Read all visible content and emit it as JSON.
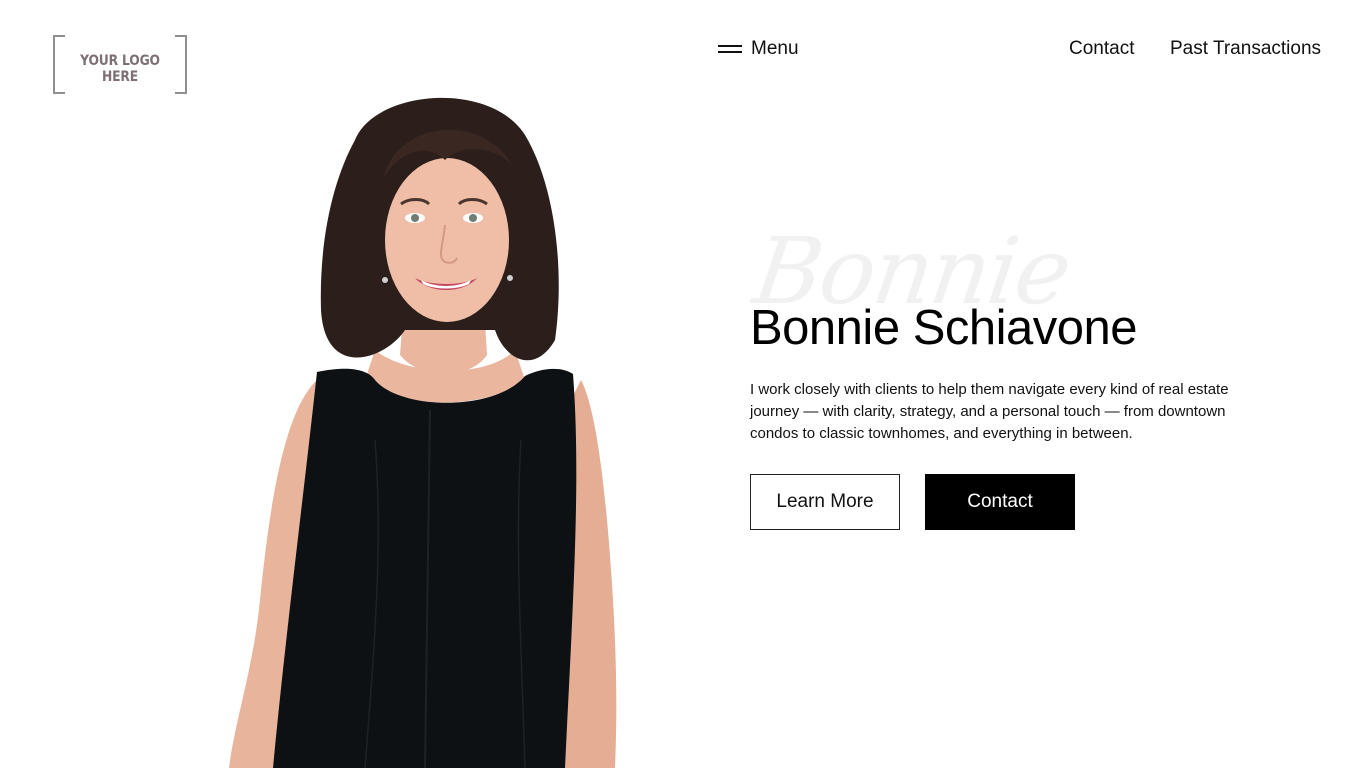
{
  "logo": {
    "text": "YOUR LOGO HERE"
  },
  "nav": {
    "menu_label": "Menu",
    "links": [
      "Contact",
      "Past Transactions"
    ]
  },
  "hero": {
    "script_text": "Bonnie",
    "title": "Bonnie Schiavone",
    "description": "I work closely with clients to help them navigate every kind of real estate journey — with clarity, strategy, and a personal touch — from downtown condos to classic townhomes, and everything in between.",
    "primary_button": "Learn More",
    "secondary_button": "Contact"
  },
  "colors": {
    "text": "#000000",
    "background": "#ffffff",
    "logo_gray": "#8f8f93",
    "button_dark": "#000000"
  },
  "icons": {
    "menu": "hamburger-icon"
  }
}
